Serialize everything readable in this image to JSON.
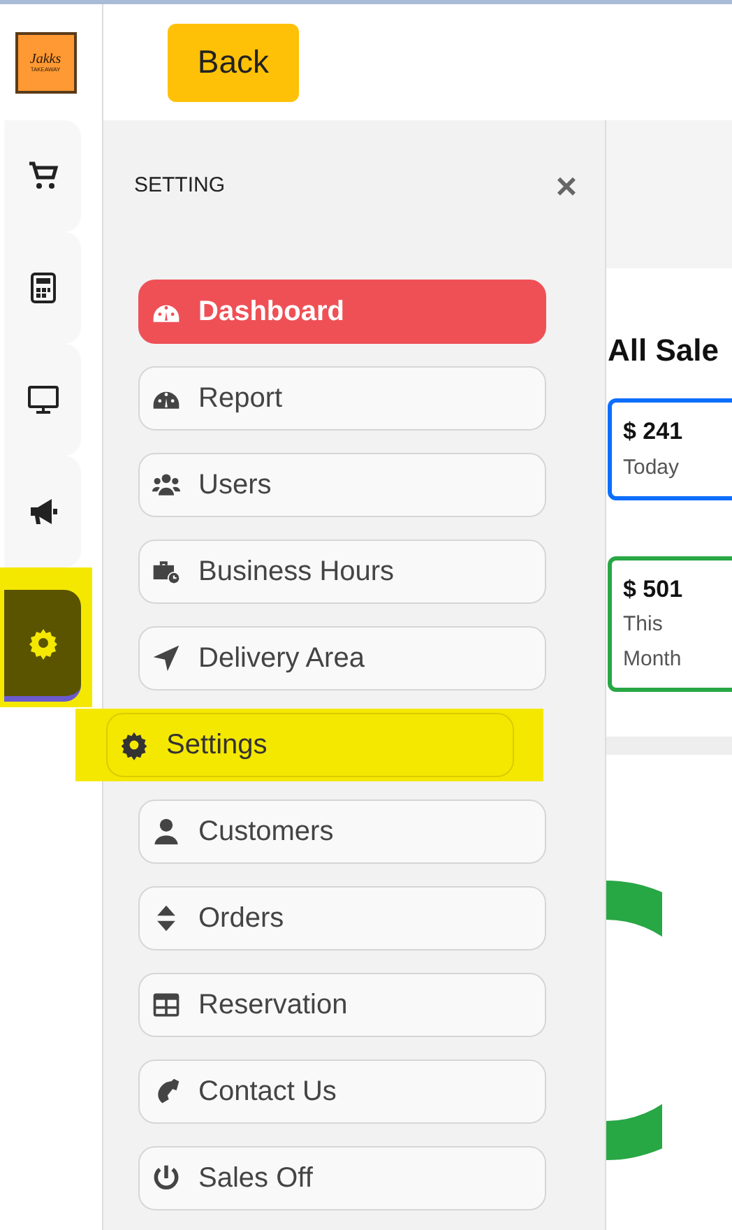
{
  "logo": {
    "title": "Jakks",
    "subtitle": "TAKEAWAY"
  },
  "back_button": {
    "label": "Back"
  },
  "rail": [
    {
      "kind": "cart",
      "selected": false,
      "highlighted": false
    },
    {
      "kind": "calculator",
      "selected": false,
      "highlighted": false
    },
    {
      "kind": "monitor",
      "selected": false,
      "highlighted": false
    },
    {
      "kind": "megaphone",
      "selected": false,
      "highlighted": false
    },
    {
      "kind": "gear",
      "selected": true,
      "highlighted": true
    }
  ],
  "panel": {
    "title": "SETTING",
    "close": "×",
    "items": [
      {
        "kind": "gauge",
        "label": "Dashboard",
        "selected": true,
        "highlighted": false
      },
      {
        "kind": "gauge",
        "label": "Report",
        "selected": false,
        "highlighted": false
      },
      {
        "kind": "users",
        "label": "Users",
        "selected": false,
        "highlighted": false
      },
      {
        "kind": "briefcase",
        "label": "Business Hours",
        "selected": false,
        "highlighted": false
      },
      {
        "kind": "arrow",
        "label": "Delivery Area",
        "selected": false,
        "highlighted": false
      },
      {
        "kind": "gear",
        "label": "Settings",
        "selected": false,
        "highlighted": true
      },
      {
        "kind": "user",
        "label": "Customers",
        "selected": false,
        "highlighted": false
      },
      {
        "kind": "sort",
        "label": "Orders",
        "selected": false,
        "highlighted": false
      },
      {
        "kind": "table",
        "label": "Reservation",
        "selected": false,
        "highlighted": false
      },
      {
        "kind": "phone",
        "label": "Contact Us",
        "selected": false,
        "highlighted": false
      },
      {
        "kind": "power",
        "label": "Sales Off",
        "selected": false,
        "highlighted": false
      }
    ]
  },
  "sales": {
    "heading": "All Sale",
    "cards": [
      {
        "amount": "$ 241",
        "period": "Today",
        "color": "#0d6efd"
      },
      {
        "amount": "$ 501",
        "period": "This Month",
        "color": "#28a745"
      }
    ]
  }
}
